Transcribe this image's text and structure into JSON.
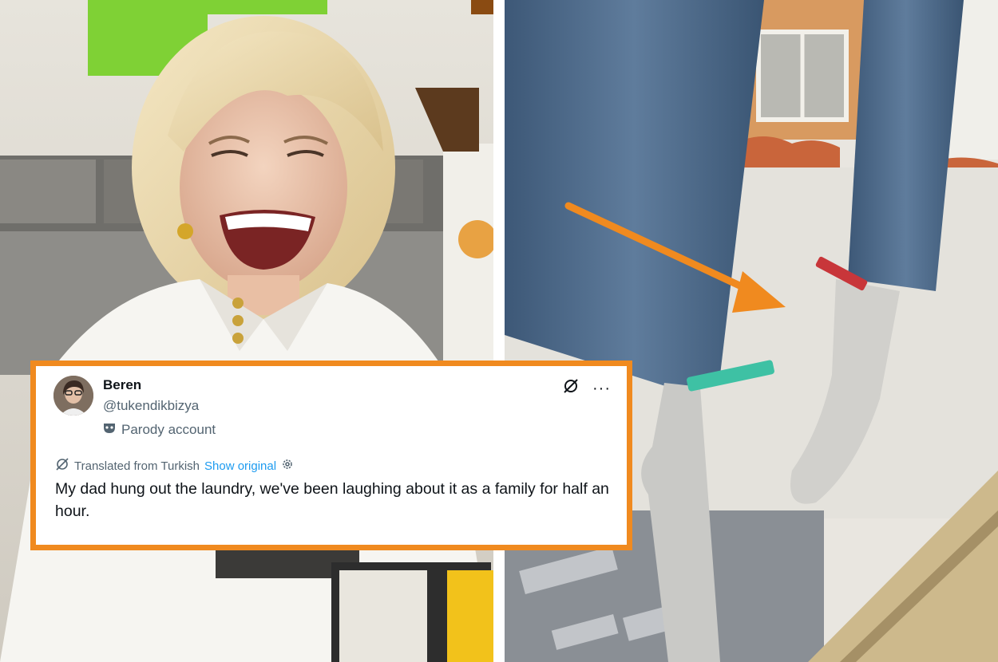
{
  "tweet": {
    "display_name": "Beren",
    "handle": "@tukendikbizya",
    "parody_label": "Parody account",
    "translated_label": "Translated from Turkish",
    "show_original_label": "Show original",
    "text": "My dad hung out the laundry, we've been laughing about it as a family for half an hour."
  },
  "icons": {
    "grok": "grok-icon",
    "more": "more-options-icon",
    "parody": "mask-icon",
    "translate": "translate-icon",
    "settings": "gear-icon"
  },
  "colors": {
    "frame_accent": "#f08a1f",
    "arrow": "#f08a1f",
    "link": "#1d9bf0",
    "secondary_text": "#536471"
  }
}
